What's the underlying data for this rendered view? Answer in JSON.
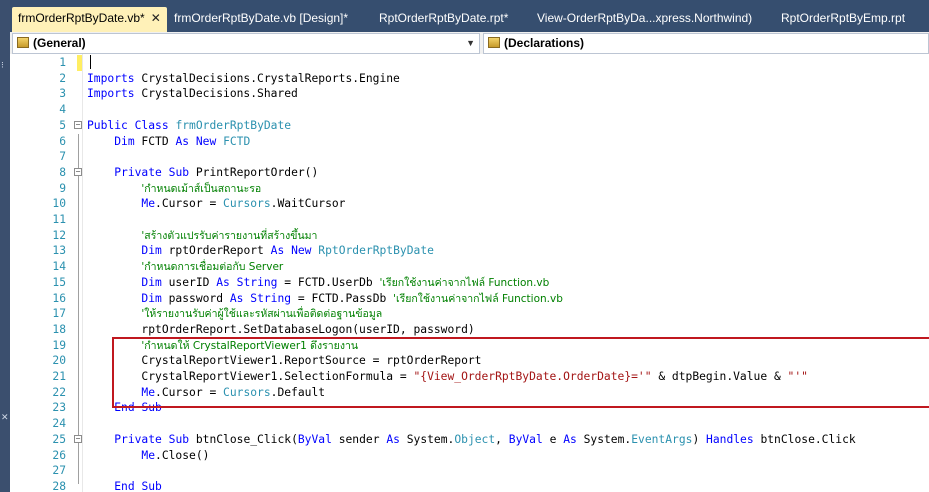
{
  "tabs": [
    {
      "label": "frmOrderRptByDate.vb*",
      "active": true,
      "close": "✕"
    },
    {
      "label": "frmOrderRptByDate.vb [Design]*",
      "active": false
    },
    {
      "label": "RptOrderRptByDate.rpt*",
      "active": false
    },
    {
      "label": "View-OrderRptByDa...xpress.Northwind)",
      "active": false
    },
    {
      "label": "RptOrderRptByEmp.rpt",
      "active": false
    }
  ],
  "navbar": {
    "class_combo": "(General)",
    "member_combo": "(Declarations)"
  },
  "code_lines": [
    {
      "n": "1",
      "html": ""
    },
    {
      "n": "2",
      "html": "<span class=\"kw\">Imports</span> CrystalDecisions.CrystalReports.Engine"
    },
    {
      "n": "3",
      "html": "<span class=\"kw\">Imports</span> CrystalDecisions.Shared"
    },
    {
      "n": "4",
      "html": ""
    },
    {
      "n": "5",
      "html": "<span class=\"kw\">Public</span> <span class=\"kw\">Class</span> <span class=\"ty\">frmOrderRptByDate</span>",
      "fold": true
    },
    {
      "n": "6",
      "html": "    <span class=\"kw\">Dim</span> FCTD <span class=\"kw\">As</span> <span class=\"kw\">New</span> <span class=\"ty\">FCTD</span>"
    },
    {
      "n": "7",
      "html": ""
    },
    {
      "n": "8",
      "html": "    <span class=\"kw\">Private</span> <span class=\"kw\">Sub</span> PrintReportOrder()",
      "fold": true
    },
    {
      "n": "9",
      "html": "        <span class=\"cm\">'กำหนดเม้าส์เป็นสถานะรอ</span>"
    },
    {
      "n": "10",
      "html": "        <span class=\"kw\">Me</span>.Cursor = <span class=\"ty\">Cursors</span>.WaitCursor"
    },
    {
      "n": "11",
      "html": ""
    },
    {
      "n": "12",
      "html": "        <span class=\"cm\">'สร้างตัวแปรรับค่ารายงานที่สร้างขึ้นมา</span>"
    },
    {
      "n": "13",
      "html": "        <span class=\"kw\">Dim</span> rptOrderReport <span class=\"kw\">As</span> <span class=\"kw\">New</span> <span class=\"ty\">RptOrderRptByDate</span>"
    },
    {
      "n": "14",
      "html": "        <span class=\"cm\">'กำหนดการเชื่อมต่อกับ Server</span>"
    },
    {
      "n": "15",
      "html": "        <span class=\"kw\">Dim</span> userID <span class=\"kw\">As</span> <span class=\"kw\">String</span> = FCTD.UserDb <span class=\"cm\">'เรียกใช้งานค่าจากไฟล์ Function.vb</span>"
    },
    {
      "n": "16",
      "html": "        <span class=\"kw\">Dim</span> password <span class=\"kw\">As</span> <span class=\"kw\">String</span> = FCTD.PassDb <span class=\"cm\">'เรียกใช้งานค่าจากไฟล์ Function.vb</span>"
    },
    {
      "n": "17",
      "html": "        <span class=\"cm\">'ให้รายงานรับค่าผู้ใช้และรหัสผ่านเพื่อติดต่อฐานข้อมูล</span>"
    },
    {
      "n": "18",
      "html": "        rptOrderReport.SetDatabaseLogon(userID, password)"
    },
    {
      "n": "19",
      "html": "        <span class=\"cm\">'กำหนดให้ CrystalReportViewer1 ดึงรายงาน</span>"
    },
    {
      "n": "20",
      "html": "        CrystalReportViewer1.ReportSource = rptOrderReport"
    },
    {
      "n": "21",
      "html": "        CrystalReportViewer1.SelectionFormula = <span class=\"st\">\"{View_OrderRptByDate.OrderDate}='\"</span> &amp; dtpBegin.Value &amp; <span class=\"st\">\"'\"</span>"
    },
    {
      "n": "22",
      "html": "        <span class=\"kw\">Me</span>.Cursor = <span class=\"ty\">Cursors</span>.Default"
    },
    {
      "n": "23",
      "html": "    <span class=\"kw\">End</span> <span class=\"kw\">Sub</span>"
    },
    {
      "n": "24",
      "html": ""
    },
    {
      "n": "25",
      "html": "    <span class=\"kw\">Private</span> <span class=\"kw\">Sub</span> btnClose_Click(<span class=\"kw\">ByVal</span> sender <span class=\"kw\">As</span> System.<span class=\"ty\">Object</span>, <span class=\"kw\">ByVal</span> e <span class=\"kw\">As</span> System.<span class=\"ty\">EventArgs</span>) <span class=\"kw\">Handles</span> btnClose.Click",
      "fold": true
    },
    {
      "n": "26",
      "html": "        <span class=\"kw\">Me</span>.Close()"
    },
    {
      "n": "27",
      "html": ""
    },
    {
      "n": "28",
      "html": "    <span class=\"kw\">End</span> <span class=\"kw\">Sub</span>"
    }
  ],
  "colors": {
    "keyword": "#0000ff",
    "type": "#2b91af",
    "comment": "#008000",
    "string": "#a31515",
    "highlight_box": "#c0181f",
    "active_tab": "#fff1b8"
  },
  "icons": {
    "tab_close": "close-icon",
    "combo_icon": "class-icon",
    "dropdown": "chevron-down-icon"
  }
}
